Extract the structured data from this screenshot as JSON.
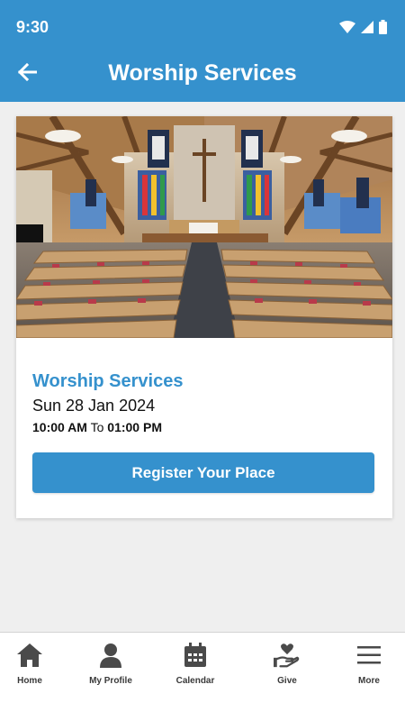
{
  "status_bar": {
    "time": "9:30"
  },
  "header": {
    "title": "Worship Services",
    "back_icon": "arrow-left-icon"
  },
  "event": {
    "title": "Worship Services",
    "date": "Sun 28 Jan 2024",
    "start_time": "10:00 AM",
    "time_separator": "To",
    "end_time": "01:00 PM",
    "register_label": "Register Your Place"
  },
  "bottom_nav": {
    "items": [
      {
        "label": "Home",
        "icon": "home-icon"
      },
      {
        "label": "My Profile",
        "icon": "person-icon"
      },
      {
        "label": "Calendar",
        "icon": "calendar-icon"
      },
      {
        "label": "Give",
        "icon": "hand-heart-icon"
      },
      {
        "label": "More",
        "icon": "menu-icon"
      }
    ]
  },
  "colors": {
    "accent": "#3591cd",
    "background": "#efefef",
    "nav_icon": "#4a4a4a"
  }
}
